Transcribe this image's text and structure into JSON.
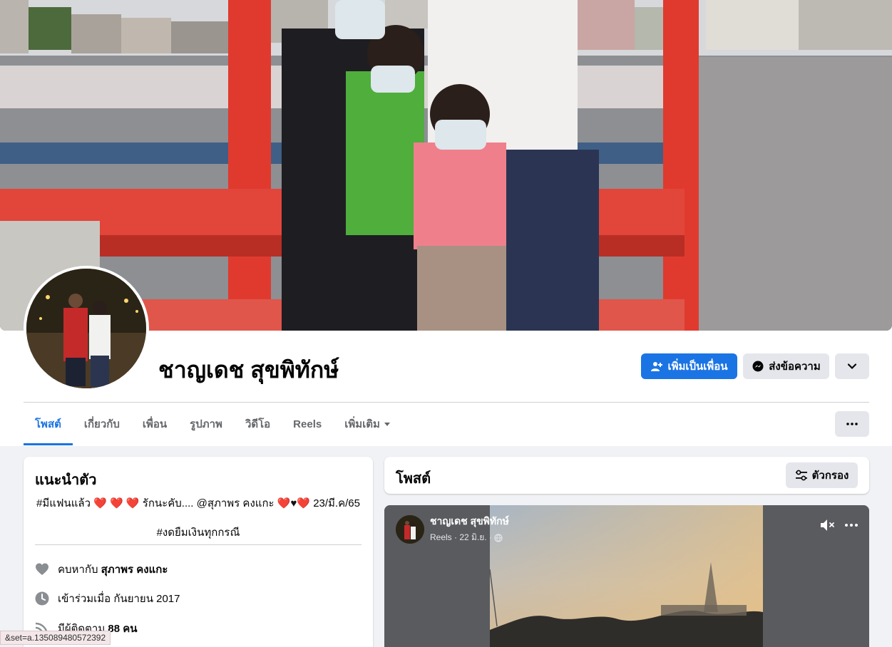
{
  "profile": {
    "name": "ชาญเดช สุขพิทักษ์"
  },
  "actions": {
    "add_friend": "เพิ่มเป็นเพื่อน",
    "message": "ส่งข้อความ"
  },
  "tabs": [
    {
      "label": "โพสต์",
      "active": true
    },
    {
      "label": "เกี่ยวกับ"
    },
    {
      "label": "เพื่อน"
    },
    {
      "label": "รูปภาพ"
    },
    {
      "label": "วิดีโอ"
    },
    {
      "label": "Reels"
    },
    {
      "label": "เพิ่มเติม"
    }
  ],
  "intro": {
    "title": "แนะนำตัว",
    "bio_line1_a": "#มีแฟนแล้ว",
    "bio_line1_b": "รักนะคับ.... @สุภาพร คงแกะ",
    "bio_line1_c": "23/มี.ค/65",
    "bio_line2": "#งดยืมเงินทุกกรณี",
    "relationship_prefix": "คบหากับ",
    "relationship_partner": "สุภาพร คงแกะ",
    "joined": "เข้าร่วมเมื่อ กันยายน 2017",
    "followers_prefix": "มีผู้ติดตาม",
    "followers_count": "88 คน"
  },
  "posts": {
    "title": "โพสต์",
    "filter_label": "ตัวกรอง"
  },
  "reel": {
    "author": "ชาญเดช สุขพิทักษ์",
    "meta": "Reels · 22 มิ.ย. ·"
  },
  "status_bar": {
    "url": "&set=a.135089480572392"
  },
  "colors": {
    "accent": "#1b74e4",
    "background": "#f0f2f5",
    "secondary_button": "#e4e6eb",
    "heart": "#e0245e"
  },
  "icons": {
    "add_friend": "person-plus-icon",
    "message": "messenger-icon",
    "more": "chevron-down-icon",
    "tab_more": "ellipsis-icon",
    "relationship": "heart-icon",
    "joined": "clock-icon",
    "followers": "rss-icon",
    "filter": "sliders-icon",
    "mute": "speaker-muted-icon",
    "privacy": "globe-icon"
  }
}
